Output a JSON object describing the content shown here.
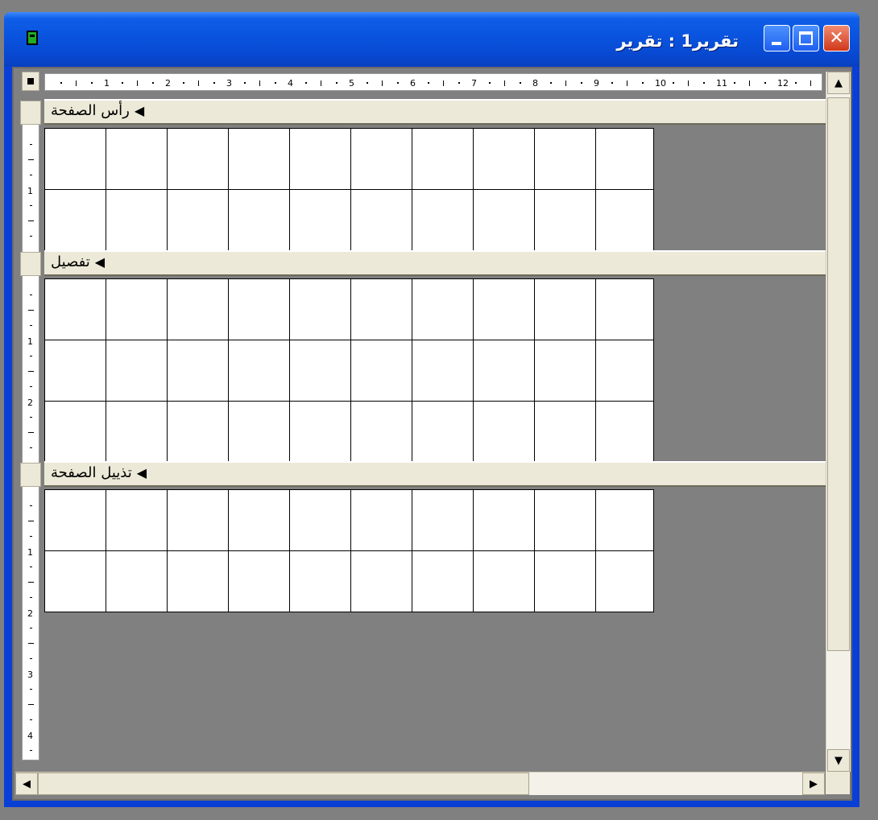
{
  "window": {
    "title": "تقرير1 : تقرير",
    "buttons": {
      "minimize": "minimize",
      "maximize": "maximize",
      "close": "✕"
    }
  },
  "ruler": {
    "horizontal": [
      "1",
      "2",
      "3",
      "4",
      "5",
      "6",
      "7",
      "8",
      "9",
      "10",
      "11",
      "12"
    ],
    "vertical_header": [
      "1"
    ],
    "vertical_detail": [
      "1",
      "2"
    ],
    "vertical_footer": [
      "1",
      "2",
      "3",
      "4"
    ]
  },
  "sections": {
    "page_header": {
      "label": "رأس الصفحة"
    },
    "detail": {
      "label": "تفصيل"
    },
    "page_footer": {
      "label": "تذييل الصفحة"
    }
  },
  "scrollbars": {
    "up": "▲",
    "down": "▼",
    "left": "◀",
    "right": "▶"
  }
}
